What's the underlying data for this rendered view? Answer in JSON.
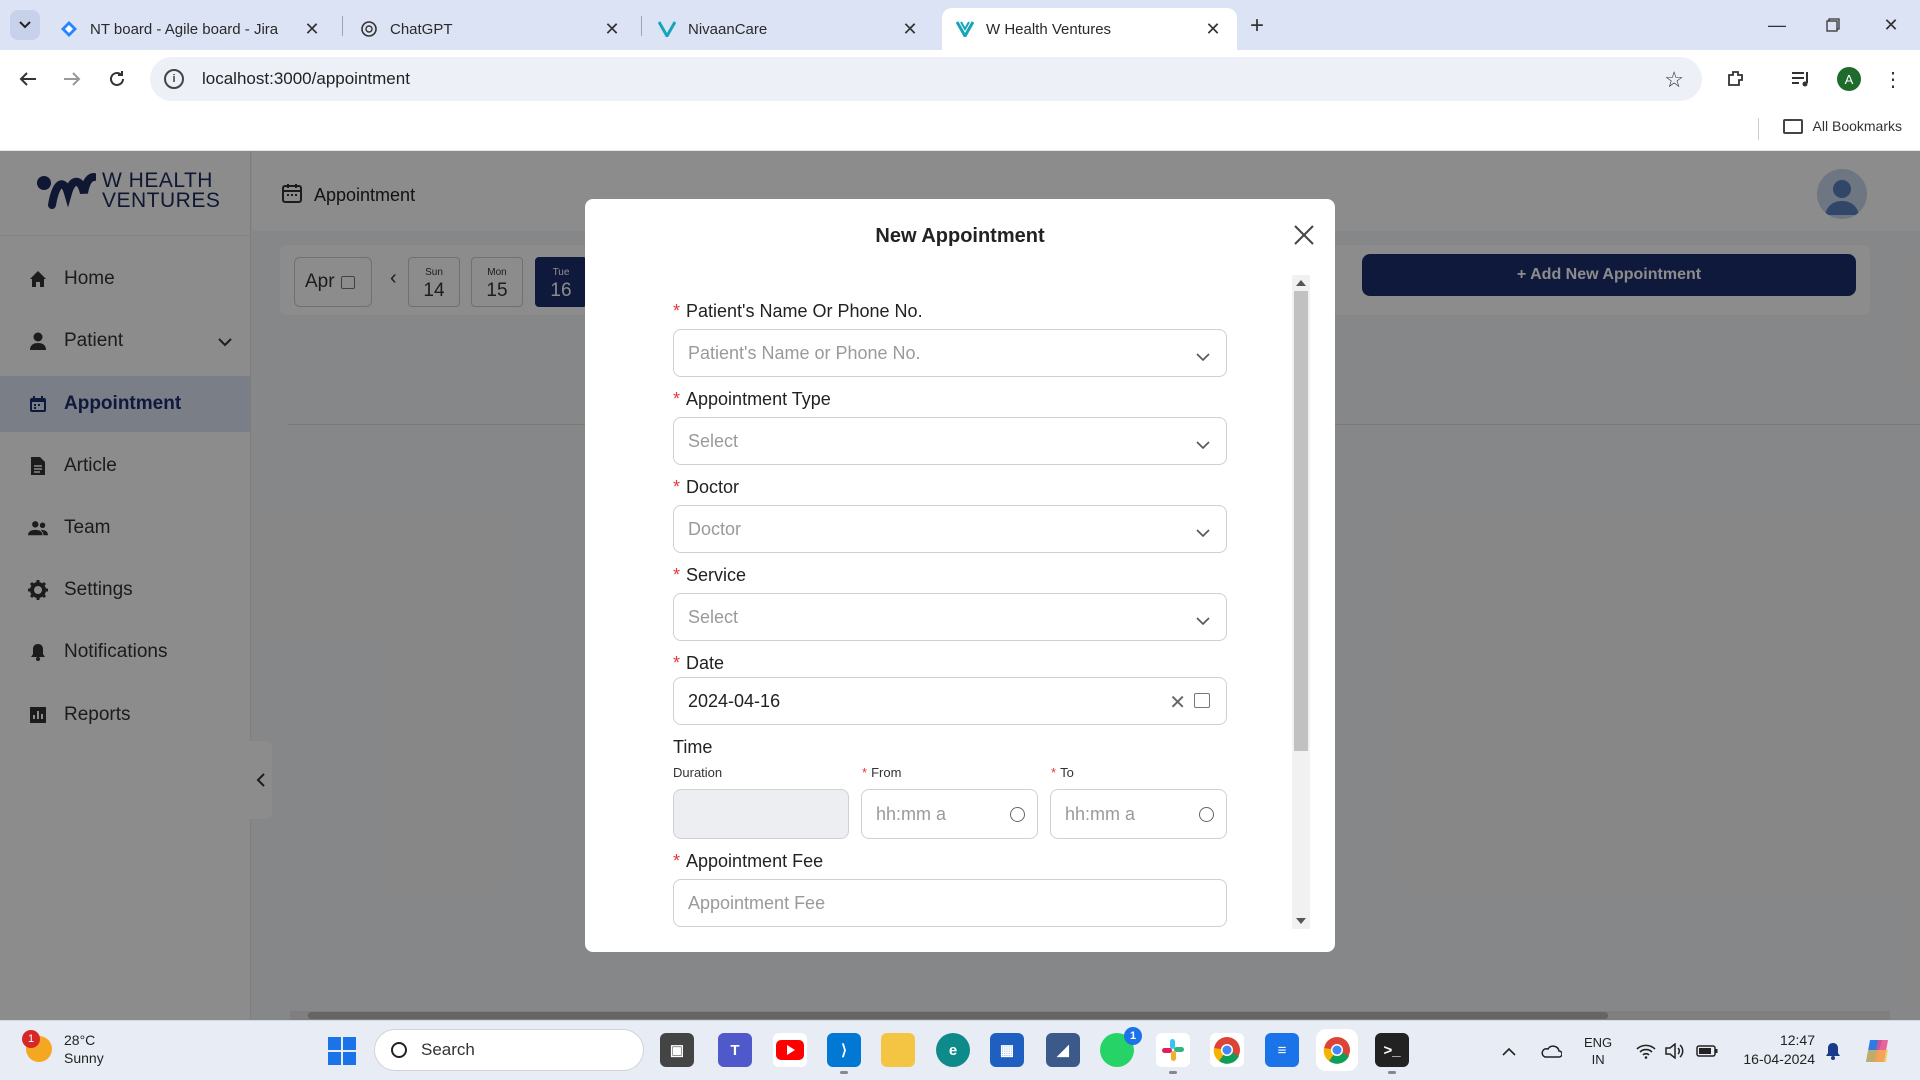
{
  "browser": {
    "tabs": [
      {
        "title": "NT board - Agile board - Jira",
        "icon": "jira-icon"
      },
      {
        "title": "ChatGPT",
        "icon": "chatgpt-icon"
      },
      {
        "title": "NivaanCare",
        "icon": "nivaancare-icon"
      },
      {
        "title": "W Health Ventures",
        "icon": "whealth-icon",
        "active": true
      }
    ],
    "url": "localhost:3000/appointment",
    "profile_initial": "A",
    "all_bookmarks": "All Bookmarks"
  },
  "app": {
    "logo_line1": "W HEALTH",
    "logo_line2": "VENTURES",
    "page_title": "Appointment",
    "sidebar": [
      {
        "label": "Home",
        "icon": "home-icon"
      },
      {
        "label": "Patient",
        "icon": "user-icon",
        "expandable": true
      },
      {
        "label": "Appointment",
        "icon": "calendar-icon",
        "active": true
      },
      {
        "label": "Article",
        "icon": "document-icon"
      },
      {
        "label": "Team",
        "icon": "team-icon"
      },
      {
        "label": "Settings",
        "icon": "gear-icon"
      },
      {
        "label": "Notifications",
        "icon": "bell-icon"
      },
      {
        "label": "Reports",
        "icon": "chart-icon"
      }
    ],
    "month": "Apr",
    "days": [
      {
        "name": "Sun",
        "num": "14"
      },
      {
        "name": "Mon",
        "num": "15"
      },
      {
        "name": "Tue",
        "num": "16",
        "active": true
      }
    ],
    "add_button": "+ Add New Appointment",
    "brand_color": "#1c2e6e"
  },
  "modal": {
    "title": "New Appointment",
    "patient": {
      "label": "Patient's Name Or Phone No.",
      "placeholder": "Patient's Name or Phone No."
    },
    "appointment_type": {
      "label": "Appointment Type",
      "placeholder": "Select"
    },
    "doctor": {
      "label": "Doctor",
      "placeholder": "Doctor"
    },
    "service": {
      "label": "Service",
      "placeholder": "Select"
    },
    "date": {
      "label": "Date",
      "value": "2024-04-16"
    },
    "time": {
      "label": "Time",
      "duration_label": "Duration",
      "from_label": "From",
      "from_placeholder": "hh:mm a",
      "to_label": "To",
      "to_placeholder": "hh:mm a"
    },
    "fee": {
      "label": "Appointment Fee",
      "placeholder": "Appointment Fee"
    }
  },
  "taskbar": {
    "temperature": "28°C",
    "weather": "Sunny",
    "weather_badge": "1",
    "search": "Search",
    "whatsapp_badge": "1",
    "lang_line1": "ENG",
    "lang_line2": "IN",
    "time": "12:47",
    "date": "16-04-2024"
  }
}
